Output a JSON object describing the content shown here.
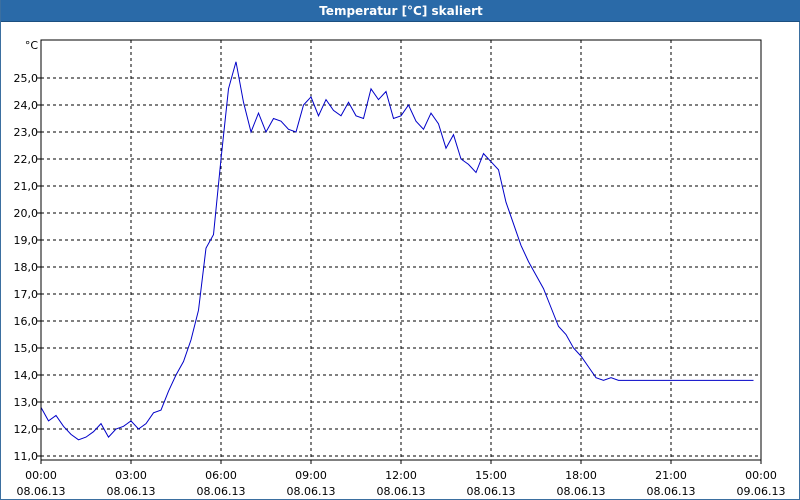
{
  "window": {
    "title": "Temperatur [°C] skaliert"
  },
  "chart_data": {
    "type": "line",
    "title": "Temperatur [°C] skaliert",
    "ylabel": "°C",
    "xlabel": "",
    "ylim": [
      11.0,
      25.8
    ],
    "xlim": [
      0,
      24
    ],
    "grid": true,
    "y_ticks": [
      "11,0",
      "12,0",
      "13,0",
      "14,0",
      "15,0",
      "16,0",
      "17,0",
      "18,0",
      "19,0",
      "20,0",
      "21,0",
      "22,0",
      "23,0",
      "24,0",
      "25,0"
    ],
    "x_ticks": [
      {
        "time": "00:00",
        "date": "08.06.13"
      },
      {
        "time": "03:00",
        "date": "08.06.13"
      },
      {
        "time": "06:00",
        "date": "08.06.13"
      },
      {
        "time": "09:00",
        "date": "08.06.13"
      },
      {
        "time": "12:00",
        "date": "08.06.13"
      },
      {
        "time": "15:00",
        "date": "08.06.13"
      },
      {
        "time": "18:00",
        "date": "08.06.13"
      },
      {
        "time": "21:00",
        "date": "08.06.13"
      },
      {
        "time": "00:00",
        "date": "09.06.13"
      }
    ],
    "series": [
      {
        "color": "#0000c8",
        "x": [
          0.0,
          0.25,
          0.5,
          0.75,
          1.0,
          1.25,
          1.5,
          1.75,
          2.0,
          2.25,
          2.5,
          2.75,
          3.0,
          3.25,
          3.5,
          3.75,
          4.0,
          4.25,
          4.5,
          4.75,
          5.0,
          5.25,
          5.5,
          5.75,
          6.0,
          6.25,
          6.5,
          6.75,
          7.0,
          7.25,
          7.5,
          7.75,
          8.0,
          8.25,
          8.5,
          8.75,
          9.0,
          9.25,
          9.5,
          9.75,
          10.0,
          10.25,
          10.5,
          10.75,
          11.0,
          11.25,
          11.5,
          11.75,
          12.0,
          12.25,
          12.5,
          12.75,
          13.0,
          13.25,
          13.5,
          13.75,
          14.0,
          14.25,
          14.5,
          14.75,
          15.0,
          15.25,
          15.5,
          15.75,
          16.0,
          16.25,
          16.5,
          16.75,
          17.0,
          17.25,
          17.5,
          17.75,
          18.0,
          18.25,
          18.5,
          18.75,
          19.0,
          19.25,
          19.5,
          19.75,
          20.0,
          20.25,
          20.5,
          20.75,
          21.0,
          21.25,
          21.5,
          21.75,
          22.0,
          22.25,
          22.5,
          22.75,
          23.0,
          23.25,
          23.5,
          23.75
        ],
        "y": [
          12.8,
          12.3,
          12.5,
          12.1,
          11.8,
          11.6,
          11.7,
          11.9,
          12.2,
          11.7,
          12.0,
          12.1,
          12.3,
          12.0,
          12.2,
          12.6,
          12.7,
          13.4,
          14.0,
          14.5,
          15.3,
          16.4,
          18.7,
          19.2,
          22.0,
          24.6,
          25.6,
          24.1,
          23.0,
          23.7,
          23.0,
          23.5,
          23.4,
          23.1,
          23.0,
          24.0,
          24.3,
          23.6,
          24.2,
          23.8,
          23.6,
          24.1,
          23.6,
          23.5,
          24.6,
          24.2,
          24.5,
          23.5,
          23.6,
          24.0,
          23.4,
          23.1,
          23.7,
          23.3,
          22.4,
          22.9,
          22.0,
          21.8,
          21.5,
          22.2,
          21.9,
          21.6,
          20.4,
          19.6,
          18.8,
          18.2,
          17.7,
          17.2,
          16.5,
          15.8,
          15.5,
          15.0,
          14.7,
          14.3,
          13.9,
          13.8,
          13.9,
          13.8,
          13.8,
          13.8,
          13.8,
          13.8,
          13.8,
          13.8,
          13.8,
          13.8,
          13.8,
          13.8,
          13.8,
          13.8,
          13.8,
          13.8,
          13.8,
          13.8,
          13.8,
          13.8
        ]
      }
    ]
  }
}
